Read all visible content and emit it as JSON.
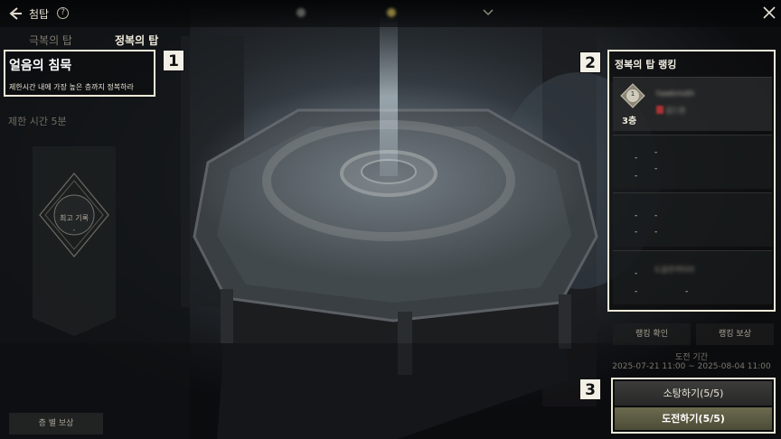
{
  "header": {
    "title": "첨탑",
    "help_icon": "?",
    "close_icon": "close-icon",
    "back_icon": "back-arrow-icon"
  },
  "tabs": [
    {
      "label": "극복의 탑",
      "active": false
    },
    {
      "label": "정복의 탑",
      "active": true
    }
  ],
  "stage": {
    "title": "얼음의 침묵",
    "description": "제한시간 내에 가장 높은 층까지 정복하라",
    "time_limit": "제한 시간 5분",
    "best_record_label": "최고 기록",
    "best_record_value": "-",
    "floor_reward_label": "층 별 보상"
  },
  "markers": [
    "1",
    "2",
    "3"
  ],
  "ranking": {
    "title": "정복의 탑 랭킹",
    "entries": [
      {
        "rank": "1",
        "floor": "3층",
        "name": "hawkmoth",
        "guild": "길드명"
      },
      {
        "d1": "-",
        "d2": "-",
        "d3": "-",
        "d4": "-"
      },
      {
        "d1": "-",
        "d2": "-",
        "d3": "-",
        "d4": "-"
      },
      {
        "name": "도굴꾼카타리",
        "d1": "-",
        "d2": "-",
        "d3": "-"
      }
    ],
    "check_label": "랭킹 확인",
    "reward_label": "랭킹 보상",
    "period_label": "도전 기간",
    "period_value": "2025-07-21 11:00 ~ 2025-08-04 11:00"
  },
  "actions": {
    "sweep_label": "소탕하기(5/5)",
    "challenge_label": "도전하기(5/5)"
  },
  "colors": {
    "highlight_border": "#efe9d8",
    "challenge_button": "#5c5b42",
    "panel_bg": "#141516"
  }
}
